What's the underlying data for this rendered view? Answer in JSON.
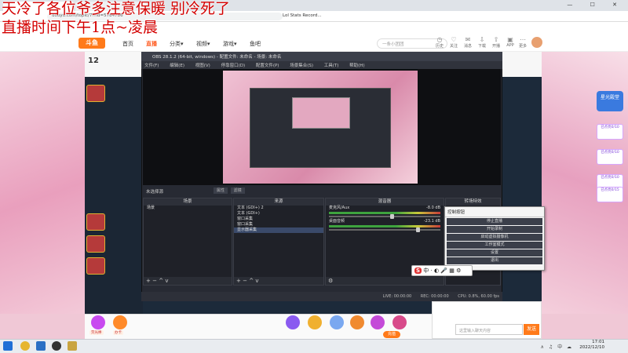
{
  "overlay": {
    "line1": "天冷了各位爷多注意保暖 别冷死了",
    "line2": "直播时间下午1点~凌晨"
  },
  "browser": {
    "tabs": [
      {
        "label": "",
        "active": true
      },
      {
        "label": "",
        "active": false
      },
      {
        "label": "Lol Stats Record..",
        "active": false
      }
    ],
    "url": "douyu.com/topic/7?rid=5784786",
    "bookmark": "Lol Stats Record...",
    "window_controls": "— ☐ ✕"
  },
  "site": {
    "logo": "斗鱼",
    "nav": [
      {
        "label": "首页",
        "active": false
      },
      {
        "label": "直播",
        "active": true
      },
      {
        "label": "分类▾",
        "active": false
      },
      {
        "label": "视频▾",
        "active": false
      },
      {
        "label": "游戏▾",
        "active": false
      },
      {
        "label": "鱼吧",
        "active": false
      }
    ],
    "search_placeholder": "一条小团团",
    "header_icons": [
      {
        "icon": "history-icon",
        "label": "历史"
      },
      {
        "icon": "follow-icon",
        "label": "关注"
      },
      {
        "icon": "message-icon",
        "label": "消息"
      },
      {
        "icon": "download-icon",
        "label": "下载"
      },
      {
        "icon": "upload-icon",
        "label": "开播"
      },
      {
        "icon": "live-icon",
        "label": "APP"
      },
      {
        "icon": "more-icon",
        "label": "更多"
      }
    ],
    "live_count": "12"
  },
  "obs": {
    "title": "OBS 28.1.2 (64-bit, windows) - 配置文件: 未命名 - 场景: 未命名",
    "menu": [
      "文件(F)",
      "编辑(E)",
      "视图(V)",
      "停靠窗口(D)",
      "配置文件(P)",
      "场景集合(S)",
      "工具(T)",
      "帮助(H)"
    ],
    "no_scene": "未选择源",
    "no_scene_buttons": [
      "属性",
      "滤镜"
    ],
    "docks": {
      "scenes": "场景",
      "sources": "来源",
      "mixer": "混音器",
      "transitions": "转场特效"
    },
    "scenes_list": [
      "场景"
    ],
    "sources_list": [
      {
        "label": "文本 (GDI+) 2",
        "selected": false
      },
      {
        "label": "文本 (GDI+)",
        "selected": false
      },
      {
        "label": "窗口采集",
        "selected": false
      },
      {
        "label": "窗口采集",
        "selected": false
      },
      {
        "label": "显示器采集",
        "selected": true
      }
    ],
    "mixer": [
      {
        "name": "桌面音频",
        "db": "-23.1 dB",
        "level": 0.78
      },
      {
        "name": "麦克风/Aux",
        "db": "-8.0 dB",
        "level": 0.55
      }
    ],
    "controls_title": "控制按钮",
    "controls": [
      "停止直播",
      "开始录制",
      "启动虚拟摄像机",
      "工作室模式",
      "设置",
      "退出"
    ],
    "status": {
      "live": "LIVE: 00:00:00",
      "rec": "REC: 00:00:00",
      "cpu": "CPU: 0.8%, 60.00 fps"
    },
    "foot_icons": [
      "+",
      "−",
      "^",
      "v"
    ]
  },
  "ime": {
    "label": "S",
    "extra": "中 · ◐ 🎤 ▦ ⚙"
  },
  "gifts": [
    {
      "label": "荧光棒",
      "color": "#c84af0"
    },
    {
      "label": "办卡",
      "color": "#ff8a2a"
    },
    {
      "label": "",
      "color": "#8a5af0"
    },
    {
      "label": "",
      "color": "#f0b030"
    },
    {
      "label": "",
      "color": "#7aa8f0"
    },
    {
      "label": "",
      "color": "#f08a30"
    },
    {
      "label": "",
      "color": "#c44ad8"
    },
    {
      "label": "",
      "color": "#d84a8a"
    }
  ],
  "chat": {
    "placeholder": "这里输入聊天内容",
    "send": "发送"
  },
  "charge": "充值",
  "promo": {
    "title": "星光殿堂",
    "badges": [
      "已点亮0/10",
      "已点亮0/10",
      "已点亮0/10",
      "已点亮0/15"
    ]
  },
  "taskbar": {
    "time": "17:01",
    "date": "2022/12/10",
    "tray": "∧ ♫ 中 ☁"
  }
}
